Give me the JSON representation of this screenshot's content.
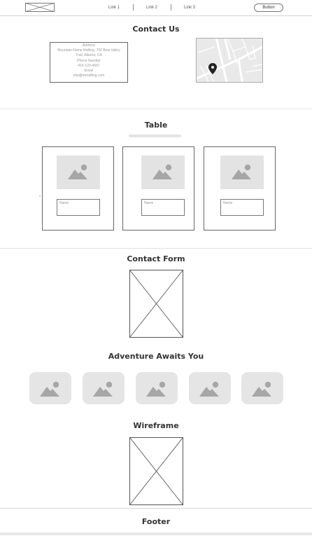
{
  "header": {
    "logo_icon": "image-placeholder-icon",
    "nav_links": [
      "Link 1",
      "Link 2",
      "Link 3"
    ],
    "button_label": "Button"
  },
  "contact_us": {
    "title": "Contact Us",
    "address_lines": [
      "Address",
      "Mountain Name Rafting, 702 Bow Valley",
      "Trail, Alberta, CA",
      "Phone Number",
      "416-123-4567",
      "Email",
      "info@mnrafting.com"
    ],
    "map_icon": "map-pin-icon"
  },
  "table": {
    "title": "Table",
    "cards": [
      {
        "image_icon": "image-icon",
        "input_placeholder": "Name"
      },
      {
        "image_icon": "image-icon",
        "input_placeholder": "Name"
      },
      {
        "image_icon": "image-icon",
        "input_placeholder": "Name"
      }
    ],
    "prev_icon": "chevron-left-icon"
  },
  "contact_form": {
    "title": "Contact Form",
    "placeholder_icon": "x-placeholder-icon"
  },
  "gallery": {
    "title": "Adventure Awaits You",
    "tile_count": 5,
    "tile_icon": "image-icon"
  },
  "wireframe": {
    "title": "Wireframe",
    "placeholder_icon": "x-placeholder-icon"
  },
  "footer": {
    "title": "Footer"
  },
  "colors": {
    "placeholder_fill": "#e3e3e3",
    "icon_gray": "#a6a6a6",
    "border": "#666666"
  }
}
